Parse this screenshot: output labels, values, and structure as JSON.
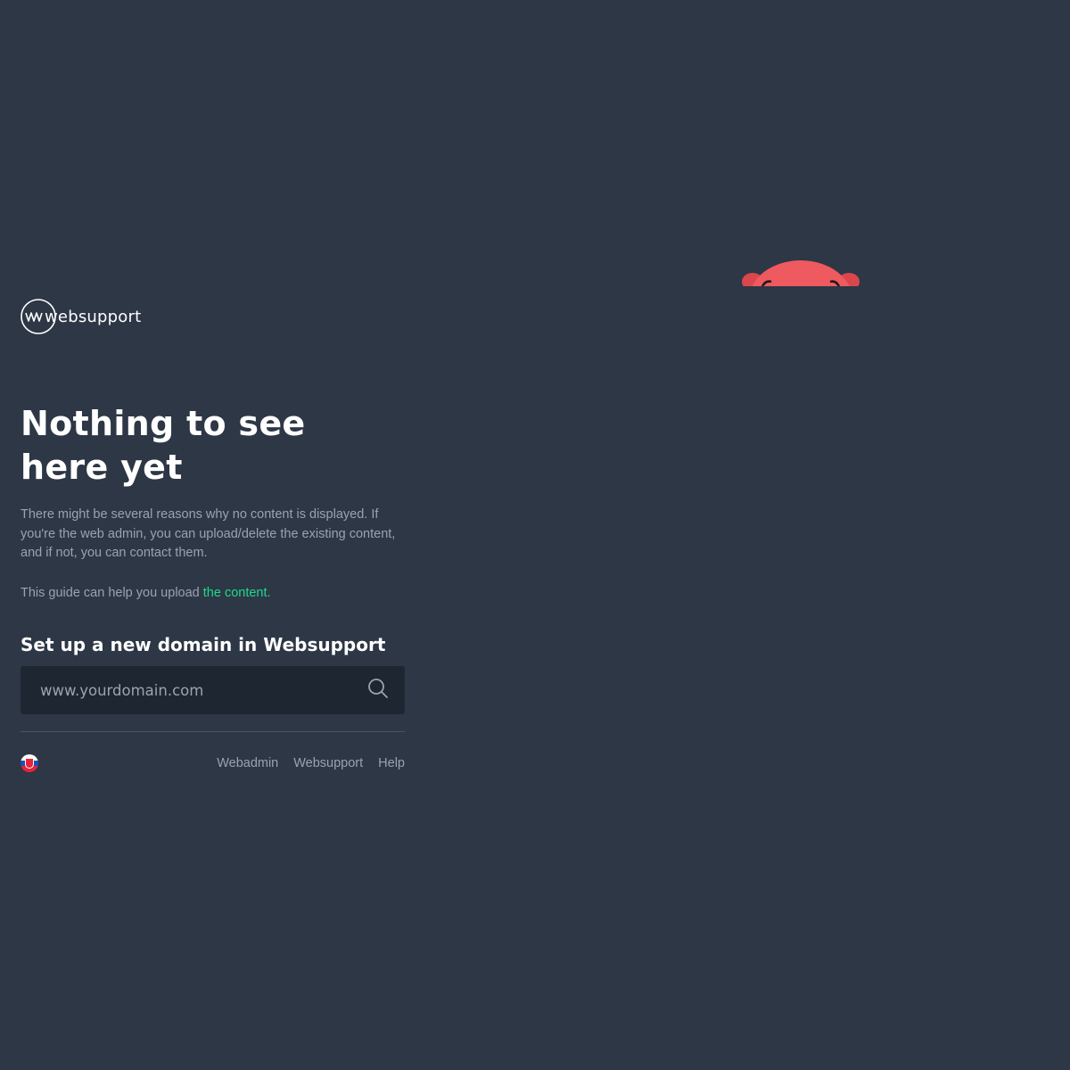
{
  "brand": {
    "name": "websupport"
  },
  "hero": {
    "title_line1": "Nothing to see",
    "title_line2": "here yet",
    "description": "There might be several reasons why no content is displayed. If you're the web admin, you can upload/delete the existing content, and if not, you can contact them.",
    "guide_prefix": "This guide can help you upload ",
    "guide_link": "the content."
  },
  "domain_search": {
    "heading": "Set up a new domain in Websupport",
    "placeholder": "www.yourdomain.com",
    "value": "",
    "button_icon": "search-icon"
  },
  "footer": {
    "language_flag": "slovakia-flag-icon",
    "links": [
      "Webadmin",
      "Websupport",
      "Help"
    ]
  },
  "colors": {
    "background": "#2d3745",
    "input_background": "#1e2631",
    "accent_link": "#1ed98c",
    "muted_text": "#9aa3b0",
    "mascot": "#ee5a5f"
  },
  "mascot_icon": "red-mascot-peeking-icon"
}
